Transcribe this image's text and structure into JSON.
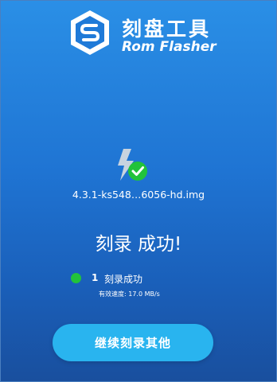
{
  "header": {
    "title": "刻盘工具",
    "subtitle": "Rom Flasher",
    "logo_icon": "hexagon-s-logo-icon"
  },
  "status": {
    "icon": "lightning-check-icon",
    "file_name": "4.3.1-ks548…6056-hd.img",
    "result_title": "刻录 成功!"
  },
  "detail": {
    "slot_number": "1",
    "slot_status": "刻录成功",
    "speed": "有效速度: 17.0 MB/s",
    "status_color": "#22c33a"
  },
  "actions": {
    "continue_label": "继续刻录其他"
  },
  "colors": {
    "background_top": "#2a8fe6",
    "background_bottom": "#194f9e",
    "button": "#29b4ef",
    "success": "#22c33a"
  }
}
